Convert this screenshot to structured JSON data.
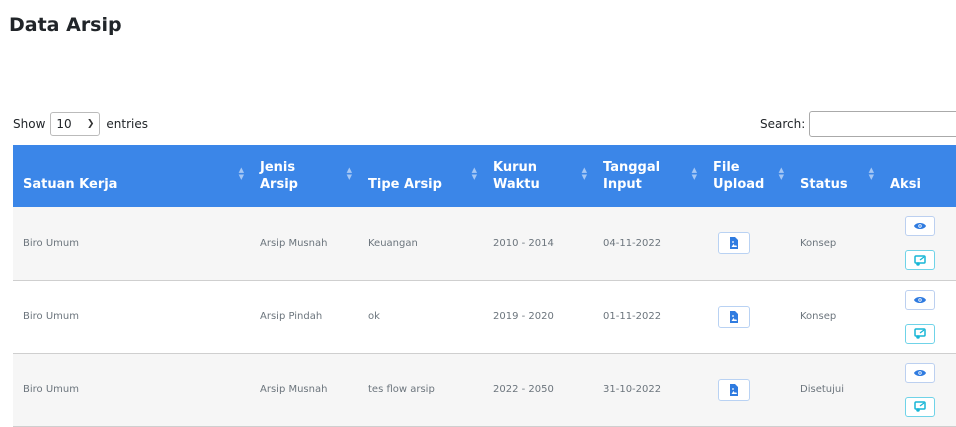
{
  "page": {
    "title": "Data Arsip"
  },
  "length_control": {
    "show_label": "Show",
    "selected": "10",
    "entries_label": "entries"
  },
  "search": {
    "label": "Search:",
    "value": ""
  },
  "table": {
    "headers": [
      "Satuan Kerja",
      "Jenis Arsip",
      "Tipe Arsip",
      "Kurun Waktu",
      "Tanggal Input",
      "File Upload",
      "Status",
      "Aksi"
    ],
    "header_lines": {
      "jenis": [
        "Jenis",
        "Arsip"
      ],
      "kurun": [
        "Kurun",
        "Waktu"
      ],
      "tanggal": [
        "Tanggal",
        "Input"
      ],
      "file": [
        "File",
        "Upload"
      ]
    },
    "rows": [
      {
        "satuan_kerja": "Biro Umum",
        "jenis_arsip": "Arsip Musnah",
        "tipe_arsip": "Keuangan",
        "kurun_waktu": "2010 - 2014",
        "tanggal_input": "04-11-2022",
        "status": "Konsep"
      },
      {
        "satuan_kerja": "Biro Umum",
        "jenis_arsip": "Arsip Pindah",
        "tipe_arsip": "ok",
        "kurun_waktu": "2019 - 2020",
        "tanggal_input": "01-11-2022",
        "status": "Konsep"
      },
      {
        "satuan_kerja": "Biro Umum",
        "jenis_arsip": "Arsip Musnah",
        "tipe_arsip": "tes flow arsip",
        "kurun_waktu": "2022 - 2050",
        "tanggal_input": "31-10-2022",
        "status": "Disetujui"
      }
    ]
  },
  "icons": {
    "file": "file-image-icon",
    "view": "eye-icon",
    "edit": "edit-icon",
    "sort": "sort-icon",
    "chevron": "chevron-down-icon"
  },
  "colors": {
    "header_bg": "#3b86e8",
    "file_icon": "#2f7be0",
    "view_icon": "#2f7be0",
    "edit_icon": "#17b6d6"
  }
}
